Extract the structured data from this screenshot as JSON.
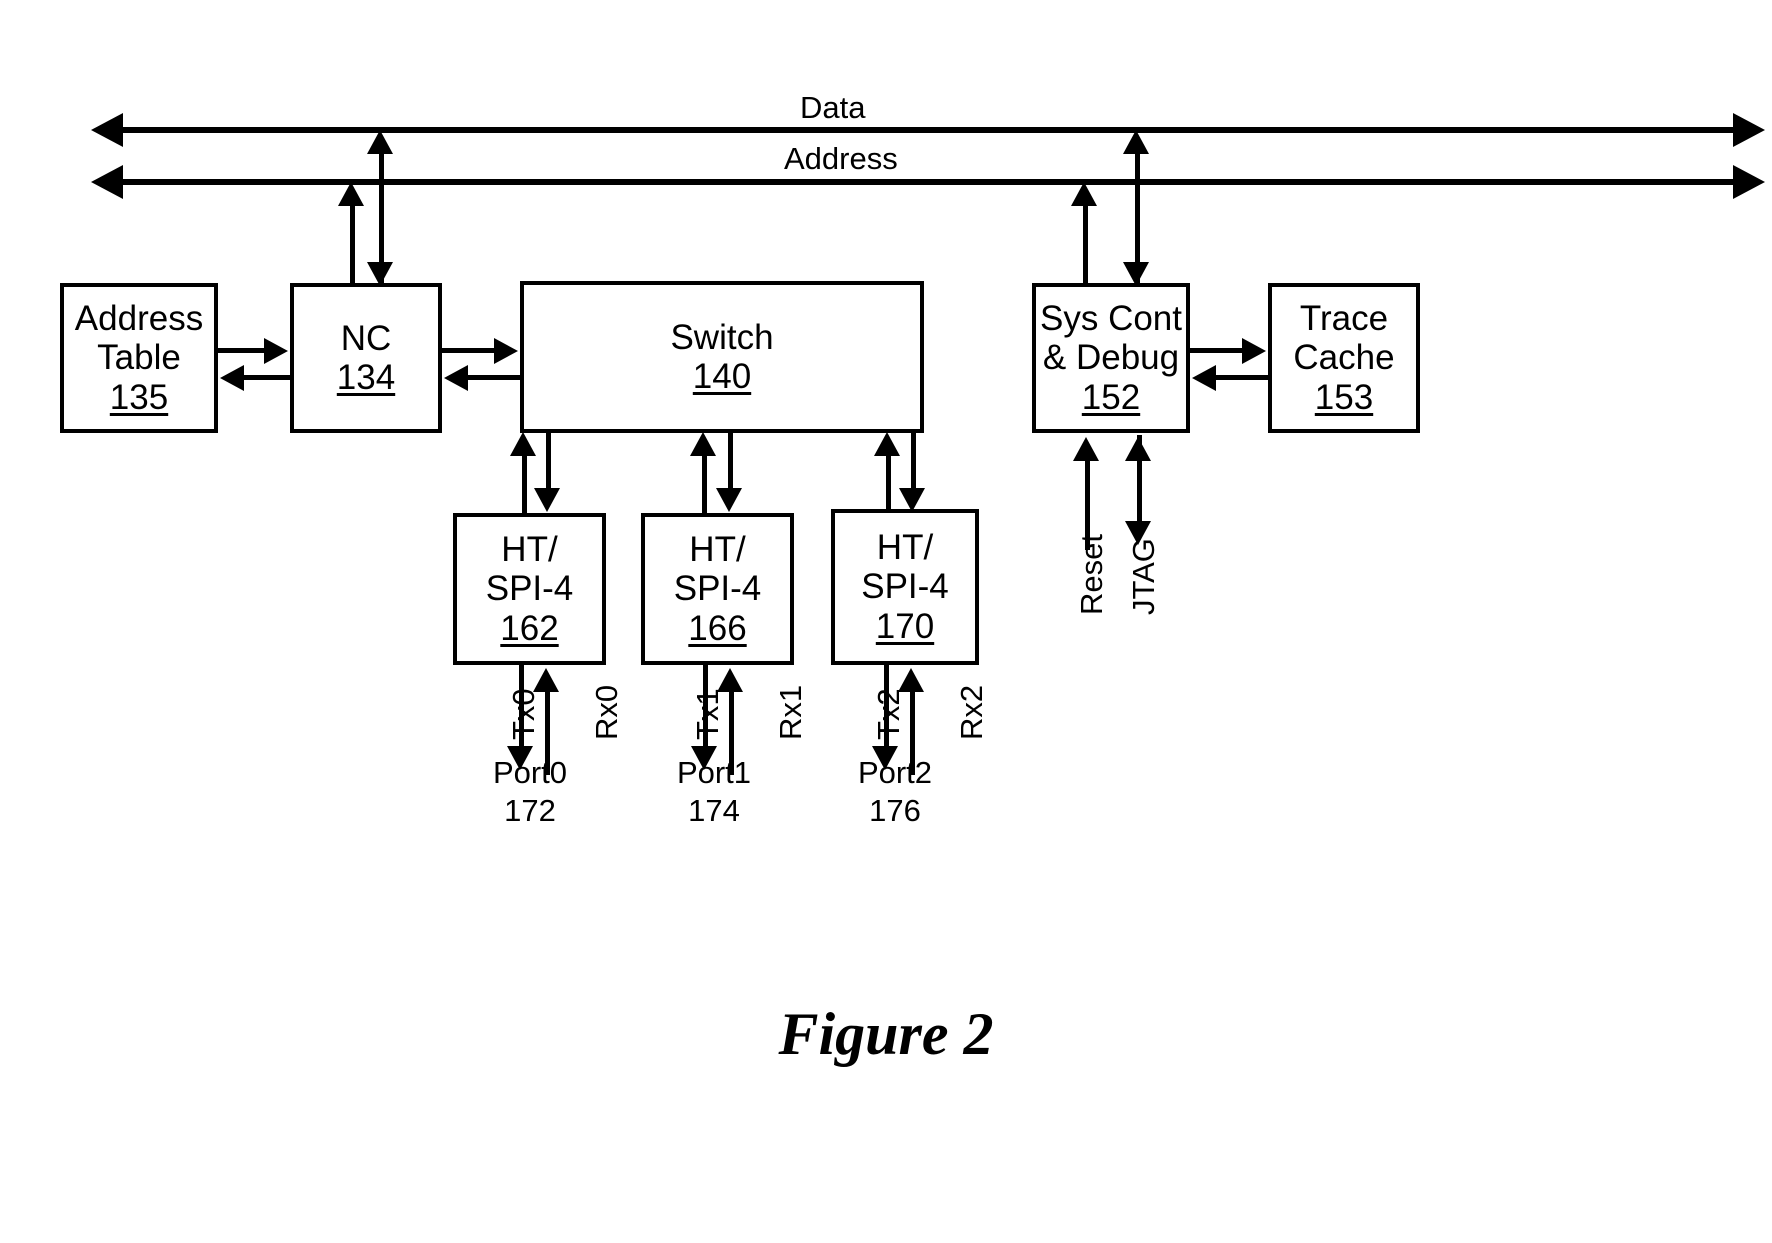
{
  "figure": {
    "caption": "Figure 2"
  },
  "buses": [
    {
      "label": "Data"
    },
    {
      "label": "Address"
    }
  ],
  "blocks": {
    "address_table": {
      "line1": "Address",
      "line2": "Table",
      "ref": "135"
    },
    "nc": {
      "line1": "NC",
      "ref": "134"
    },
    "switch": {
      "line1": "Switch",
      "ref": "140"
    },
    "sys_cont": {
      "line1": "Sys Cont",
      "line2": "& Debug",
      "ref": "152"
    },
    "trace_cache": {
      "line1": "Trace",
      "line2": "Cache",
      "ref": "153"
    },
    "ht0": {
      "line1": "HT/",
      "line2": "SPI-4",
      "ref": "162"
    },
    "ht1": {
      "line1": "HT/",
      "line2": "SPI-4",
      "ref": "166"
    },
    "ht2": {
      "line1": "HT/",
      "line2": "SPI-4",
      "ref": "170"
    }
  },
  "signals": {
    "tx0": "Tx0",
    "rx0": "Rx0",
    "tx1": "Tx1",
    "rx1": "Rx1",
    "tx2": "Tx2",
    "rx2": "Rx2",
    "reset": "Reset",
    "jtag": "JTAG"
  },
  "ports": [
    {
      "name": "Port0",
      "ref": "172"
    },
    {
      "name": "Port1",
      "ref": "174"
    },
    {
      "name": "Port2",
      "ref": "176"
    }
  ],
  "colors": {
    "ink": "#000000",
    "paper": "#ffffff"
  }
}
